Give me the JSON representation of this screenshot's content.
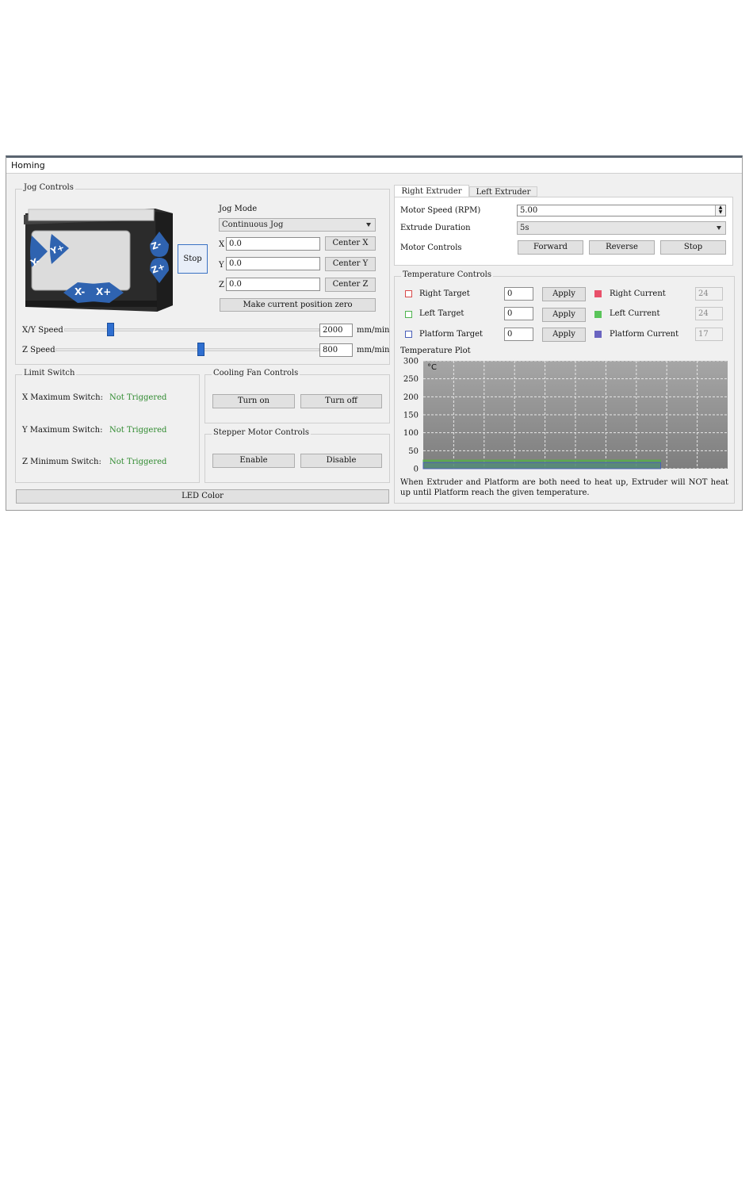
{
  "window": {
    "title": "Homing"
  },
  "jog": {
    "group_title": "Jog Controls",
    "buttons": {
      "y_minus": "Y-",
      "y_plus": "Y+",
      "x_minus": "X-",
      "x_plus": "X+",
      "z_minus": "Z-",
      "z_plus": "Z+"
    },
    "stop_label": "Stop",
    "mode_label": "Jog Mode",
    "mode_value": "Continuous Jog",
    "x_label": "X",
    "x_value": "0.0",
    "center_x": "Center X",
    "y_label": "Y",
    "y_value": "0.0",
    "center_y": "Center Y",
    "z_label": "Z",
    "z_value": "0.0",
    "center_z": "Center Z",
    "make_zero": "Make current position zero",
    "xy_speed_label": "X/Y Speed",
    "xy_speed_value": "2000",
    "xy_speed_unit": "mm/min",
    "xy_slider_fraction": 0.18,
    "z_speed_label": "Z Speed",
    "z_speed_value": "800",
    "z_speed_unit": "mm/min",
    "z_slider_fraction": 0.55
  },
  "limit": {
    "group_title": "Limit Switch",
    "rows": [
      {
        "label": "X Maximum Switch:",
        "status": "Not Triggered"
      },
      {
        "label": "Y Maximum Switch:",
        "status": "Not Triggered"
      },
      {
        "label": "Z Minimum Switch:",
        "status": "Not Triggered"
      }
    ]
  },
  "fan": {
    "group_title": "Cooling Fan Controls",
    "on": "Turn on",
    "off": "Turn off"
  },
  "stepper": {
    "group_title": "Stepper Motor Controls",
    "enable": "Enable",
    "disable": "Disable"
  },
  "led_label": "LED Color",
  "extruder_tabs": {
    "tabs": [
      "Right Extruder",
      "Left Extruder"
    ],
    "active": 0,
    "motor_speed_label": "Motor Speed (RPM)",
    "motor_speed_value": "5.00",
    "extrude_duration_label": "Extrude Duration",
    "extrude_duration_value": "5s",
    "motor_controls_label": "Motor Controls",
    "forward": "Forward",
    "reverse": "Reverse",
    "stop": "Stop"
  },
  "temperature": {
    "group_title": "Temperature Controls",
    "apply_label": "Apply",
    "rows": [
      {
        "target_label": "Right Target",
        "target_value": "0",
        "current_label": "Right Current",
        "current_value": "24",
        "color": "#d84a4a",
        "current_color": "#e8506a"
      },
      {
        "target_label": "Left Target",
        "target_value": "0",
        "current_label": "Left Current",
        "current_value": "24",
        "color": "#4fb34f",
        "current_color": "#5ac45a"
      },
      {
        "target_label": "Platform Target",
        "target_value": "0",
        "current_label": "Platform Current",
        "current_value": "17",
        "color": "#4a5fb8",
        "current_color": "#6a64c0"
      }
    ],
    "plot_label": "Temperature Plot",
    "note": "When Extruder and Platform are both need to heat up, Extruder will NOT heat up until Platform reach the given temperature."
  },
  "chart_data": {
    "type": "area",
    "y_unit": "°C",
    "ylim": [
      0,
      300
    ],
    "yticks": [
      "300",
      "250",
      "200",
      "150",
      "100",
      "50",
      "0"
    ],
    "grid": true,
    "series": [
      {
        "color": "#d84a4a",
        "values": [
          24,
          24,
          24,
          24,
          24,
          24,
          24,
          24
        ]
      },
      {
        "color": "#4fb34f",
        "values": [
          24,
          24,
          24,
          24,
          24,
          24,
          24,
          24
        ]
      },
      {
        "color": "#4a5fb8",
        "values": [
          17,
          17,
          17,
          17,
          17,
          17,
          17,
          17
        ]
      }
    ]
  }
}
